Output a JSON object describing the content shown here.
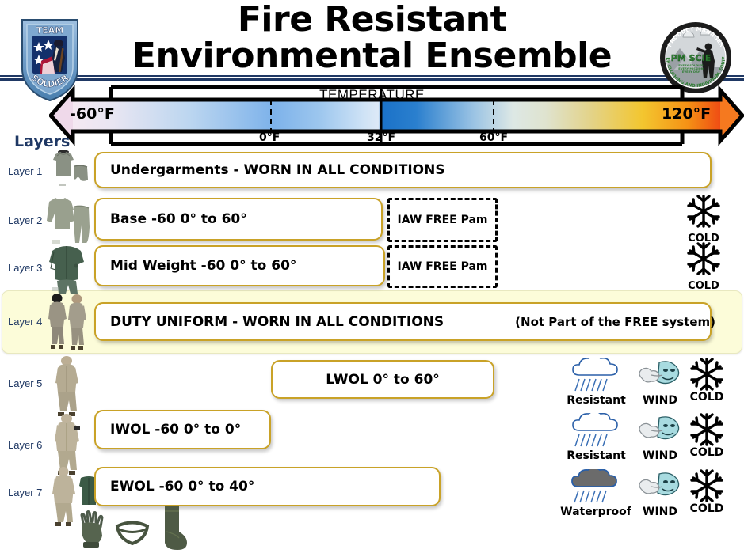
{
  "title": {
    "line1": "Fire Resistant",
    "line2": "Environmental Ensemble"
  },
  "logos": {
    "left": {
      "name": "team-soldier-shield",
      "top_text": "TEAM",
      "bottom_text": "SOLDIER"
    },
    "right": {
      "name": "pm-scie-seal",
      "center_text": "PM SCIE",
      "arc_top": "PRODUCT MANAGER",
      "arc_bottom": "SOLDIER CLOTHING AND INDIVIDUAL EQUIPMENT",
      "tagline": "EVERY SOLDIER EVERY MISSION EVERY DAY"
    }
  },
  "temperature_scale": {
    "axis_label": "TEMPERATURE",
    "min_label": "-60°F",
    "max_label": "120°F",
    "ticks": [
      {
        "label": "0°F",
        "value": 0
      },
      {
        "label": "32°F",
        "value": 32
      },
      {
        "label": "60°F",
        "value": 60
      }
    ],
    "colors": {
      "cold_end": "#f3e4ef",
      "cool": "#6aa9e8",
      "freeze": "#1b72c8",
      "mild": "#dfe7dc",
      "warm": "#f0c93c",
      "hot_end": "#f05a16",
      "arrow_left_fill": "#efd9ea",
      "arrow_right_fill": "#f5791f"
    }
  },
  "layers_heading": "Layers",
  "layers": [
    {
      "id": "layer-1",
      "label": "Layer 1",
      "garment": "t-shirt-and-briefs",
      "box_text": "Undergarments - WORN IN ALL CONDITIONS",
      "box_note": "",
      "iaw_note": "",
      "conditions": []
    },
    {
      "id": "layer-2",
      "label": "Layer 2",
      "garment": "long-underwear-set",
      "box_text": "Base  -60 0° to 60°",
      "box_note": "",
      "iaw_note": "IAW FREE Pam",
      "conditions": [
        "COLD"
      ]
    },
    {
      "id": "layer-3",
      "label": "Layer 3",
      "garment": "mid-weight-fleece",
      "box_text": "Mid Weight  -60 0° to 60°",
      "box_note": "",
      "iaw_note": "IAW FREE Pam",
      "conditions": [
        "COLD"
      ]
    },
    {
      "id": "layer-4",
      "label": "Layer 4",
      "garment": "duty-uniform-soldiers",
      "box_text": "DUTY UNIFORM - WORN IN ALL CONDITIONS",
      "box_note": "(Not Part of the FREE system)",
      "iaw_note": "",
      "conditions": [],
      "highlighted": true
    },
    {
      "id": "layer-5",
      "label": "Layer 5",
      "garment": "light-weight-outer-layer",
      "box_text": "LWOL  0° to 60°",
      "box_note": "",
      "iaw_note": "",
      "conditions": [
        "Resistant",
        "WIND",
        "COLD"
      ]
    },
    {
      "id": "layer-6",
      "label": "Layer 6",
      "garment": "intermediate-weight-outer-layer",
      "box_text": "IWOL  -60 0° to 0°",
      "box_note": "",
      "iaw_note": "",
      "conditions": [
        "Resistant",
        "WIND",
        "COLD"
      ]
    },
    {
      "id": "layer-7",
      "label": "Layer 7",
      "garment": "extreme-weather-outer-layer",
      "box_text": "EWOL  -60 0° to 40°",
      "box_note": "",
      "iaw_note": "",
      "conditions": [
        "Waterproof",
        "WIND",
        "COLD"
      ]
    }
  ],
  "condition_labels": {
    "rain_resistant": "Resistant",
    "waterproof": "Waterproof",
    "wind": "WIND",
    "cold": "COLD"
  },
  "accessories": [
    {
      "name": "glove",
      "label": ""
    },
    {
      "name": "neck-gaiter",
      "label": ""
    },
    {
      "name": "sock",
      "label": ""
    }
  ]
}
